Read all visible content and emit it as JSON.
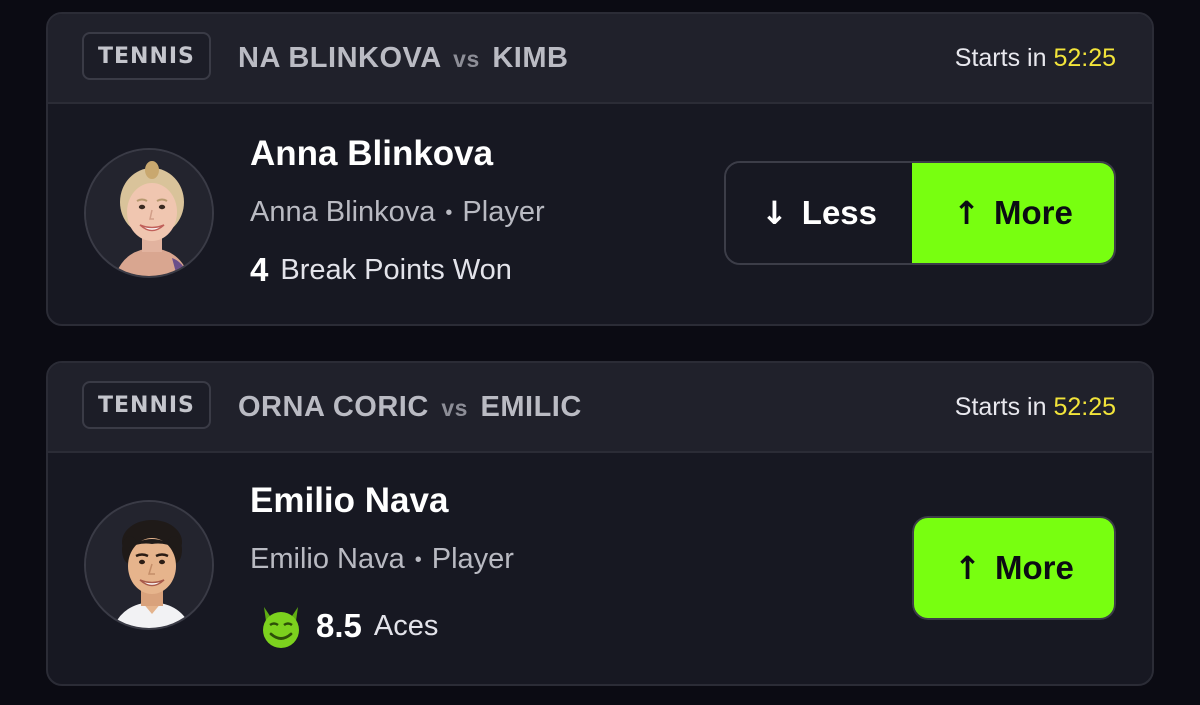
{
  "cards": [
    {
      "sport": "TENNIS",
      "matchup": {
        "player_a": "NA BLINKOVA",
        "vs": "vs",
        "player_b": "KIMB"
      },
      "starts_label": "Starts in",
      "starts_timer": "52:25",
      "player_name": "Anna Blinkova",
      "player_team": "Anna Blinkova",
      "player_role": "Player",
      "stat_value": "4",
      "stat_label": "Break Points Won",
      "less_label": "Less",
      "more_label": "More",
      "has_demon": false
    },
    {
      "sport": "TENNIS",
      "matchup": {
        "player_a": "ORNA CORIC",
        "vs": "vs",
        "player_b": "EMILIC"
      },
      "starts_label": "Starts in",
      "starts_timer": "52:25",
      "player_name": "Emilio Nava",
      "player_team": "Emilio Nava",
      "player_role": "Player",
      "stat_value": "8.5",
      "stat_label": "Aces",
      "more_label": "More",
      "has_demon": true
    }
  ],
  "colors": {
    "background": "#0b0b13",
    "card": "#171822",
    "header": "#20212b",
    "accent_green": "#78ff10",
    "timer_yellow": "#f2e43a",
    "demon_green": "#7cd11e"
  },
  "icons": {
    "down_arrow": "arrow-down-icon",
    "up_arrow": "arrow-up-icon",
    "demon": "demon-face-icon"
  }
}
